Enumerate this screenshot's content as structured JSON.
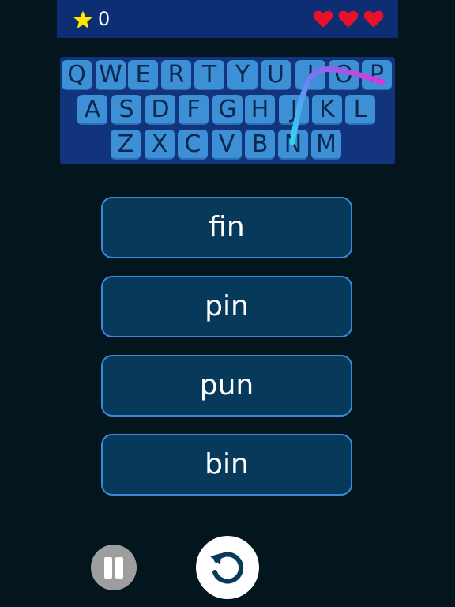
{
  "hud": {
    "score": "0",
    "lives": 3,
    "star_color": "#ffe600",
    "heart_color": "#e8102a"
  },
  "keyboard": {
    "rows": [
      [
        "Q",
        "W",
        "E",
        "R",
        "T",
        "Y",
        "U",
        "I",
        "O",
        "P"
      ],
      [
        "A",
        "S",
        "D",
        "F",
        "G",
        "H",
        "J",
        "K",
        "L"
      ],
      [
        "Z",
        "X",
        "C",
        "V",
        "B",
        "N",
        "M"
      ]
    ],
    "swipe_path": [
      "N",
      "I",
      "P"
    ]
  },
  "options": [
    "fin",
    "pin",
    "pun",
    "bin"
  ],
  "controls": {
    "pause_icon": "pause-icon",
    "reset_icon": "reset-icon"
  }
}
